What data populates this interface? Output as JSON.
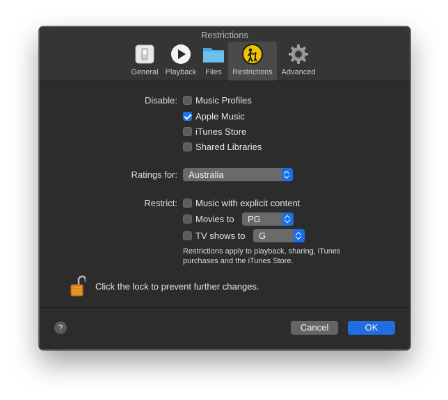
{
  "window": {
    "title": "Restrictions"
  },
  "toolbar": {
    "tabs": [
      {
        "label": "General",
        "icon": "switch-icon"
      },
      {
        "label": "Playback",
        "icon": "play-icon"
      },
      {
        "label": "Files",
        "icon": "folder-icon"
      },
      {
        "label": "Restrictions",
        "icon": "parental-controls-icon",
        "selected": true
      },
      {
        "label": "Advanced",
        "icon": "gear-icon"
      }
    ]
  },
  "disable": {
    "label": "Disable:",
    "options": [
      {
        "label": "Music Profiles",
        "checked": false
      },
      {
        "label": "Apple Music",
        "checked": true
      },
      {
        "label": "iTunes Store",
        "checked": false
      },
      {
        "label": "Shared Libraries",
        "checked": false
      }
    ]
  },
  "ratings": {
    "label": "Ratings for:",
    "value": "Australia"
  },
  "restrict": {
    "label": "Restrict:",
    "explicit_label": "Music with explicit content",
    "explicit_checked": false,
    "movies_label": "Movies to",
    "movies_checked": false,
    "movies_value": "PG",
    "tv_label": "TV shows to",
    "tv_checked": false,
    "tv_value": "G",
    "note": "Restrictions apply to playback, sharing, iTunes purchases and the iTunes Store."
  },
  "lock": {
    "text": "Click the lock to prevent further changes."
  },
  "footer": {
    "help": "?",
    "cancel": "Cancel",
    "ok": "OK"
  },
  "colors": {
    "accent": "#1a73e8",
    "window_bg": "#2c2c2c",
    "toolbar_bg": "#353535"
  }
}
